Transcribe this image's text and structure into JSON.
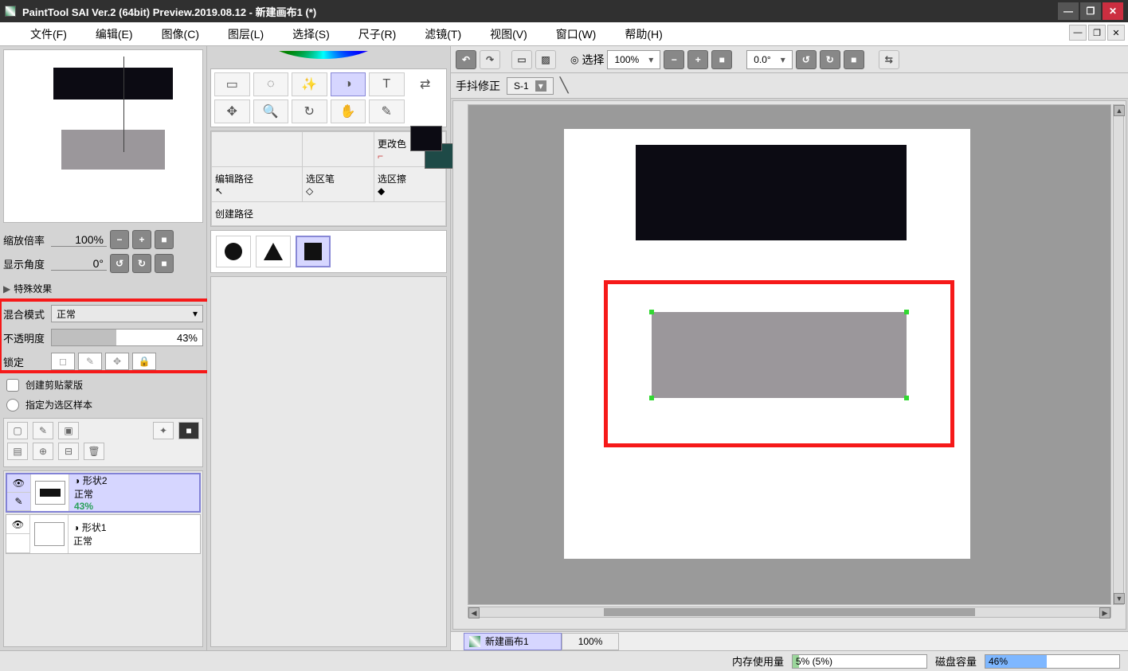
{
  "title": "PaintTool SAI Ver.2 (64bit) Preview.2019.08.12 - 新建画布1 (*)",
  "menubar": [
    "文件(F)",
    "编辑(E)",
    "图像(C)",
    "图层(L)",
    "选择(S)",
    "尺子(R)",
    "滤镜(T)",
    "视图(V)",
    "窗口(W)",
    "帮助(H)"
  ],
  "view": {
    "zoom_label": "缩放倍率",
    "zoom_value": "100%",
    "angle_label": "显示角度",
    "angle_value": "0°"
  },
  "effects_label": "特殊效果",
  "blend": {
    "label": "混合模式",
    "value": "正常"
  },
  "opacity": {
    "label": "不透明度",
    "value": "43%",
    "percent": 43
  },
  "lock_label": "锁定",
  "clip_label": "创建剪贴蒙版",
  "selsource_label": "指定为选区样本",
  "layers": [
    {
      "name": "形状2",
      "mode": "正常",
      "opacity": "43%",
      "selected": true,
      "thumb": "black"
    },
    {
      "name": "形状1",
      "mode": "正常",
      "opacity": "",
      "selected": false,
      "thumb": "empty"
    }
  ],
  "pathpanel": {
    "change_color": "更改色",
    "edit_path": "编辑路径",
    "sel_pen": "选区笔",
    "sel_eraser": "选区擦",
    "create_path": "创建路径"
  },
  "canvastoolbar": {
    "select_label": "选择",
    "zoom": "100%",
    "angle": "0.0°"
  },
  "stabilizer": {
    "label": "手抖修正",
    "value": "S-1"
  },
  "doctab": {
    "name": "新建画布1",
    "zoom": "100%"
  },
  "status": {
    "mem_label": "内存使用量",
    "mem_text": "5% (5%)",
    "mem_percent": 5,
    "disk_label": "磁盘容量",
    "disk_text": "46%",
    "disk_percent": 46
  }
}
